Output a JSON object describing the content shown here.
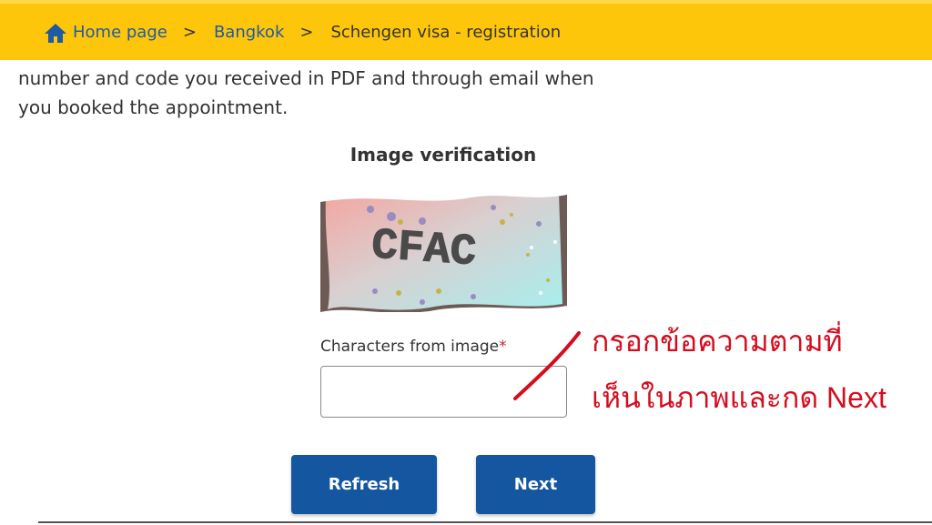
{
  "breadcrumb": {
    "home": "Home page",
    "city": "Bangkok",
    "current": "Schengen visa - registration",
    "separator": ">"
  },
  "intro": {
    "line1": "number and code you received in PDF and through email when",
    "line2": "you booked the appointment."
  },
  "verification": {
    "title": "Image verification",
    "captcha_text": "CFAC",
    "field_label": "Characters from image",
    "required_mark": "*",
    "field_value": ""
  },
  "buttons": {
    "refresh": "Refresh",
    "next": "Next"
  },
  "annotation": {
    "line1": "กรอกข้อความตามที่",
    "line2": "เห็นในภาพและกด Next"
  },
  "colors": {
    "header_bg": "#fdc60a",
    "link": "#1f5aa3",
    "button_bg": "#1456a0",
    "annotation": "#d40e1e"
  }
}
